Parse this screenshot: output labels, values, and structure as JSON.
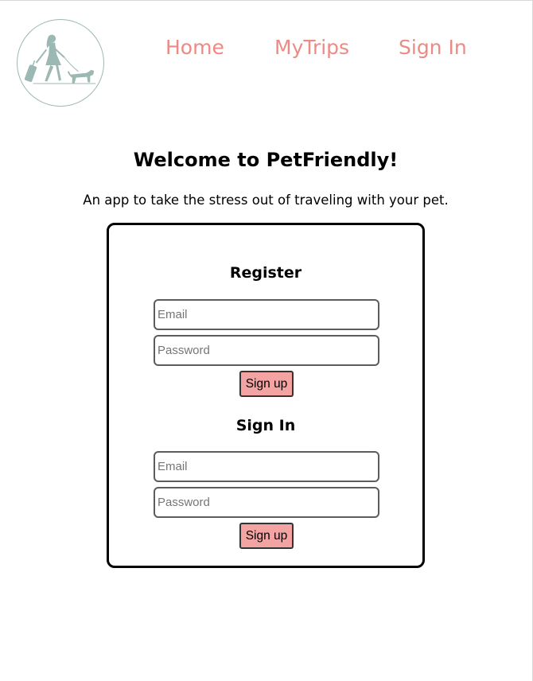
{
  "header": {
    "logo_icon": "woman-walking-dog-with-suitcase-icon",
    "logo_color": "#9bb8b3",
    "nav": {
      "home": "Home",
      "trips": "MyTrips",
      "signin": "Sign In"
    },
    "nav_color": "#ec8a84"
  },
  "intro": {
    "welcome": "Welcome to PetFriendly!",
    "tagline": "An app to take the stress out of traveling with your pet."
  },
  "register": {
    "title": "Register",
    "email_placeholder": "Email",
    "password_placeholder": "Password",
    "button_label": "Sign up"
  },
  "signin": {
    "title": "Sign In",
    "email_placeholder": "Email",
    "password_placeholder": "Password",
    "button_label": "Sign up"
  },
  "colors": {
    "button_bg": "#f4a3a3"
  }
}
